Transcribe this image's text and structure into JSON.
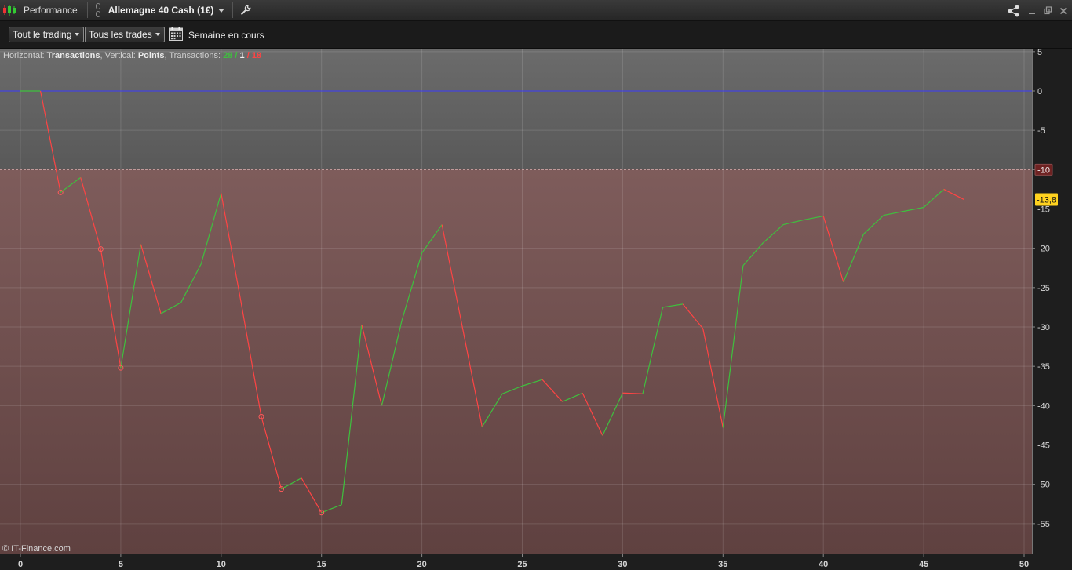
{
  "titlebar": {
    "title": "Performance",
    "instrument": "Allemagne 40 Cash (1€)"
  },
  "toolbar": {
    "scope_dropdown": "Tout le trading",
    "trades_dropdown": "Tous les trades",
    "period_label": "Semaine en cours"
  },
  "info": {
    "horizontal_label": "Horizontal:",
    "horizontal_value": "Transactions",
    "vertical_label": "Vertical:",
    "vertical_value": "Points",
    "transactions_label": "Transactions:",
    "winning": "28",
    "neutral": "1",
    "losing": "18"
  },
  "footer": {
    "copyright": "© IT-Finance.com"
  },
  "colors": {
    "gain": "#3ec13e",
    "loss": "#ff4444",
    "zero_line": "#3a3aff",
    "threshold_label_bg": "#6e2222",
    "last_value_bg": "#ffd21f"
  },
  "chart_data": {
    "type": "line",
    "xlabel": "",
    "ylabel": "",
    "xlim": [
      0,
      50
    ],
    "ylim": [
      -57,
      5
    ],
    "x_ticks": [
      0,
      5,
      10,
      15,
      20,
      25,
      30,
      35,
      40,
      45,
      50
    ],
    "y_ticks": [
      5,
      0,
      -5,
      -10,
      -15,
      -20,
      -25,
      -30,
      -35,
      -40,
      -45,
      -50,
      -55
    ],
    "zero_line": 0,
    "threshold": -10,
    "threshold_label": "-10",
    "last_value_label": "-13,8",
    "grid": true,
    "points": [
      [
        0,
        0
      ],
      [
        1,
        0
      ],
      [
        2,
        -12.9
      ],
      [
        3,
        -11
      ],
      [
        4,
        -20.1
      ],
      [
        5,
        -35.2
      ],
      [
        6,
        -19.5
      ],
      [
        7,
        -28.3
      ],
      [
        8,
        -26.9
      ],
      [
        9,
        -22
      ],
      [
        10,
        -13
      ],
      [
        11,
        -27
      ],
      [
        12,
        -41.4
      ],
      [
        13,
        -50.6
      ],
      [
        14,
        -49.2
      ],
      [
        15,
        -53.6
      ],
      [
        16,
        -52.6
      ],
      [
        17,
        -29.7
      ],
      [
        18,
        -40
      ],
      [
        19,
        -29.2
      ],
      [
        20,
        -20.6
      ],
      [
        21,
        -17
      ],
      [
        22,
        -29.8
      ],
      [
        23,
        -42.7
      ],
      [
        24,
        -38.5
      ],
      [
        25,
        -37.5
      ],
      [
        26,
        -36.7
      ],
      [
        27,
        -39.5
      ],
      [
        28,
        -38.4
      ],
      [
        29,
        -43.8
      ],
      [
        30,
        -38.4
      ],
      [
        31,
        -38.5
      ],
      [
        32,
        -27.5
      ],
      [
        33,
        -27.1
      ],
      [
        34,
        -30.2
      ],
      [
        35,
        -42.8
      ],
      [
        36,
        -22.2
      ],
      [
        37,
        -19.3
      ],
      [
        38,
        -17
      ],
      [
        39,
        -16.4
      ],
      [
        40,
        -15.9
      ],
      [
        41,
        -24.3
      ],
      [
        42,
        -18.2
      ],
      [
        43,
        -15.8
      ],
      [
        44,
        -15.3
      ],
      [
        45,
        -14.8
      ],
      [
        46,
        -12.5
      ],
      [
        47,
        -13.8
      ]
    ],
    "marked_points": [
      2,
      4,
      5,
      12,
      13,
      15
    ]
  }
}
